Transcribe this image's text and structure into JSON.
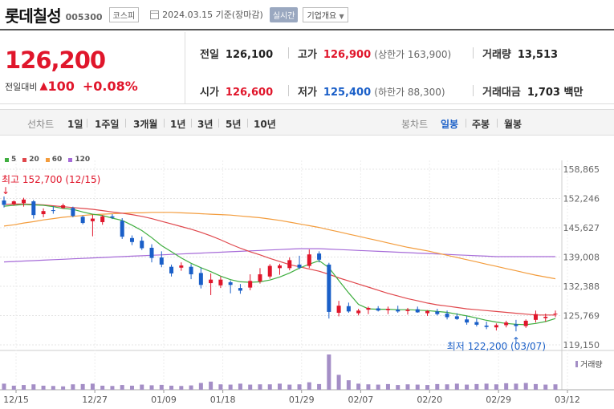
{
  "header": {
    "name": "롯데칠성",
    "code": "005300",
    "market": "코스피",
    "date": "2024.03.15  기준(장마감)",
    "realtime_label": "실시간",
    "overview_label": "기업개요"
  },
  "price": {
    "current": "126,200",
    "change_label": "전일대비",
    "change_arrow": "▲",
    "change_value": "100",
    "change_pct": "+0.08%"
  },
  "stats": {
    "prev_label": "전일",
    "prev_value": "126,100",
    "high_label": "고가",
    "high_value": "126,900",
    "upper_limit": "(상한가 163,900)",
    "volume_label": "거래량",
    "volume_value": "13,513",
    "open_label": "시가",
    "open_value": "126,600",
    "low_label": "저가",
    "low_value": "125,400",
    "lower_limit": "(하한가 88,300)",
    "amount_label": "거래대금",
    "amount_value": "1,703 백만"
  },
  "tabs": {
    "line_chart": "선차트",
    "periods": [
      "1일",
      "1주일",
      "3개월",
      "1년",
      "3년",
      "5년",
      "10년"
    ],
    "candle_chart": "봉차트",
    "candle_periods": [
      "일봉",
      "주봉",
      "월봉"
    ],
    "active_candle": "일봉"
  },
  "legend": [
    {
      "label": "5",
      "color": "#3fae3f"
    },
    {
      "label": "20",
      "color": "#e0474c"
    },
    {
      "label": "60",
      "color": "#f39c3c"
    },
    {
      "label": "120",
      "color": "#a66bd8"
    }
  ],
  "chart_data": {
    "type": "candlestick",
    "y_ticks": [
      "158,865",
      "152,246",
      "145,627",
      "139,008",
      "132,388",
      "125,769",
      "119,150"
    ],
    "ylim": [
      119150,
      158865
    ],
    "x_ticks": [
      "12/15",
      "12/27",
      "01/09",
      "01/18",
      "01/29",
      "02/07",
      "02/20",
      "02/29",
      "03/12"
    ],
    "x_tick_index": [
      0,
      8,
      15,
      21,
      29,
      35,
      42,
      49,
      56
    ],
    "annotations": {
      "high": {
        "label": "최고 152,700 (12/15)",
        "value": 152700,
        "index": 0
      },
      "low": {
        "label": "최저 122,200 (03/07)",
        "value": 122200,
        "index": 52
      }
    },
    "volume_label": "거래량",
    "candles": [
      {
        "o": 151800,
        "h": 152700,
        "l": 150200,
        "c": 150800
      },
      {
        "o": 151000,
        "h": 151800,
        "l": 150600,
        "c": 151600
      },
      {
        "o": 151200,
        "h": 152400,
        "l": 150400,
        "c": 152000
      },
      {
        "o": 151600,
        "h": 151900,
        "l": 147700,
        "c": 148500
      },
      {
        "o": 148700,
        "h": 150000,
        "l": 148000,
        "c": 149400
      },
      {
        "o": 149600,
        "h": 150500,
        "l": 148800,
        "c": 149500
      },
      {
        "o": 150100,
        "h": 151100,
        "l": 149900,
        "c": 150700
      },
      {
        "o": 150100,
        "h": 150400,
        "l": 148000,
        "c": 148300
      },
      {
        "o": 148100,
        "h": 148400,
        "l": 146400,
        "c": 146700
      },
      {
        "o": 147100,
        "h": 148600,
        "l": 143700,
        "c": 147700
      },
      {
        "o": 146900,
        "h": 148500,
        "l": 146300,
        "c": 148200
      },
      {
        "o": 148200,
        "h": 148700,
        "l": 147600,
        "c": 147900
      },
      {
        "o": 147200,
        "h": 147800,
        "l": 143100,
        "c": 143600
      },
      {
        "o": 143300,
        "h": 143900,
        "l": 141700,
        "c": 142400
      },
      {
        "o": 142700,
        "h": 143600,
        "l": 140600,
        "c": 141000
      },
      {
        "o": 141100,
        "h": 141900,
        "l": 137800,
        "c": 138800
      },
      {
        "o": 138900,
        "h": 140300,
        "l": 136700,
        "c": 137300
      },
      {
        "o": 136800,
        "h": 137300,
        "l": 134600,
        "c": 135300
      },
      {
        "o": 136600,
        "h": 137800,
        "l": 135900,
        "c": 137100
      },
      {
        "o": 136800,
        "h": 137400,
        "l": 134000,
        "c": 135100
      },
      {
        "o": 135400,
        "h": 136600,
        "l": 131900,
        "c": 132700
      },
      {
        "o": 133100,
        "h": 135300,
        "l": 130400,
        "c": 133900
      },
      {
        "o": 132600,
        "h": 134600,
        "l": 132000,
        "c": 133900
      },
      {
        "o": 133300,
        "h": 133700,
        "l": 130800,
        "c": 132700
      },
      {
        "o": 132000,
        "h": 132900,
        "l": 130700,
        "c": 131400
      },
      {
        "o": 132100,
        "h": 135100,
        "l": 131500,
        "c": 133600
      },
      {
        "o": 133500,
        "h": 136500,
        "l": 133000,
        "c": 135100
      },
      {
        "o": 134600,
        "h": 137400,
        "l": 134100,
        "c": 137000
      },
      {
        "o": 136500,
        "h": 137500,
        "l": 135000,
        "c": 137100
      },
      {
        "o": 136500,
        "h": 138900,
        "l": 136000,
        "c": 138300
      },
      {
        "o": 137300,
        "h": 139300,
        "l": 136300,
        "c": 136600
      },
      {
        "o": 137000,
        "h": 140700,
        "l": 136500,
        "c": 139600
      },
      {
        "o": 139800,
        "h": 140300,
        "l": 137800,
        "c": 138400
      },
      {
        "o": 137300,
        "h": 137700,
        "l": 125100,
        "c": 126600
      },
      {
        "o": 126400,
        "h": 129100,
        "l": 125600,
        "c": 128000
      },
      {
        "o": 127900,
        "h": 128700,
        "l": 126400,
        "c": 126700
      },
      {
        "o": 126300,
        "h": 127300,
        "l": 125800,
        "c": 126900
      },
      {
        "o": 127100,
        "h": 127800,
        "l": 126100,
        "c": 127500
      },
      {
        "o": 127400,
        "h": 127900,
        "l": 126700,
        "c": 126900
      },
      {
        "o": 127000,
        "h": 127800,
        "l": 126100,
        "c": 127300
      },
      {
        "o": 127100,
        "h": 128000,
        "l": 126400,
        "c": 126700
      },
      {
        "o": 126800,
        "h": 127500,
        "l": 126000,
        "c": 127100
      },
      {
        "o": 127200,
        "h": 127800,
        "l": 126400,
        "c": 126500
      },
      {
        "o": 126300,
        "h": 127000,
        "l": 125700,
        "c": 126800
      },
      {
        "o": 126700,
        "h": 127300,
        "l": 125800,
        "c": 126100
      },
      {
        "o": 126200,
        "h": 126900,
        "l": 124900,
        "c": 125400
      },
      {
        "o": 125600,
        "h": 126300,
        "l": 124800,
        "c": 125000
      },
      {
        "o": 124900,
        "h": 125700,
        "l": 123700,
        "c": 124200
      },
      {
        "o": 124300,
        "h": 125100,
        "l": 123300,
        "c": 123700
      },
      {
        "o": 123500,
        "h": 124400,
        "l": 122700,
        "c": 123200
      },
      {
        "o": 123100,
        "h": 124000,
        "l": 122400,
        "c": 123600
      },
      {
        "o": 123600,
        "h": 124600,
        "l": 123100,
        "c": 124200
      },
      {
        "o": 123800,
        "h": 124800,
        "l": 122200,
        "c": 123400
      },
      {
        "o": 123400,
        "h": 124900,
        "l": 123000,
        "c": 124600
      },
      {
        "o": 124800,
        "h": 126900,
        "l": 124200,
        "c": 126100
      },
      {
        "o": 125200,
        "h": 126200,
        "l": 124400,
        "c": 125500
      },
      {
        "o": 126100,
        "h": 126900,
        "l": 125400,
        "c": 126200
      }
    ],
    "volumes": [
      45,
      30,
      35,
      40,
      30,
      28,
      25,
      40,
      42,
      45,
      30,
      28,
      35,
      30,
      38,
      33,
      36,
      30,
      28,
      32,
      50,
      60,
      40,
      38,
      45,
      38,
      40,
      40,
      45,
      38,
      40,
      55,
      42,
      260,
      110,
      70,
      45,
      40,
      38,
      42,
      35,
      40,
      38,
      35,
      42,
      40,
      45,
      38,
      42,
      45,
      40,
      48,
      45,
      50,
      42,
      38,
      40
    ],
    "ma5": [
      150500,
      150700,
      150900,
      150800,
      150700,
      150400,
      150000,
      149800,
      149200,
      148700,
      148400,
      147800,
      147300,
      146200,
      145000,
      143400,
      141600,
      140200,
      138800,
      137600,
      136600,
      135700,
      134700,
      133900,
      133400,
      133300,
      133400,
      133800,
      134500,
      135400,
      136500,
      137400,
      138200,
      136600,
      133700,
      130900,
      128300,
      127300,
      127200,
      127200,
      127100,
      127100,
      127000,
      126900,
      126700,
      126500,
      126100,
      125700,
      125200,
      124700,
      124300,
      124000,
      123800,
      123700,
      124000,
      124400,
      125100
    ],
    "ma20": [
      150900,
      151000,
      151000,
      150900,
      150800,
      150600,
      150400,
      150200,
      150000,
      149800,
      149500,
      149200,
      148900,
      148600,
      148200,
      147700,
      147100,
      146500,
      145900,
      145300,
      144600,
      143800,
      142900,
      141900,
      141000,
      140200,
      139500,
      138700,
      138000,
      137300,
      136800,
      136300,
      135800,
      135100,
      134300,
      133600,
      132900,
      132200,
      131500,
      130800,
      130200,
      129600,
      129100,
      128600,
      128200,
      127900,
      127600,
      127300,
      127100,
      126900,
      126700,
      126500,
      126300,
      126100,
      125900,
      125900,
      125900
    ],
    "ma60": [
      146000,
      146300,
      146700,
      147000,
      147400,
      147700,
      148000,
      148200,
      148400,
      148600,
      148700,
      148800,
      148900,
      149000,
      149000,
      149100,
      149100,
      149100,
      149000,
      148900,
      148800,
      148700,
      148600,
      148500,
      148300,
      148100,
      147900,
      147600,
      147300,
      146900,
      146500,
      146100,
      145700,
      145200,
      144700,
      144200,
      143700,
      143200,
      142700,
      142200,
      141700,
      141200,
      140800,
      140400,
      139900,
      139400,
      138900,
      138400,
      137900,
      137400,
      136900,
      136400,
      135900,
      135400,
      134900,
      134500,
      134100
    ],
    "ma120": [
      137900,
      138000,
      138100,
      138200,
      138300,
      138400,
      138500,
      138600,
      138700,
      138800,
      138900,
      139000,
      139100,
      139200,
      139300,
      139400,
      139500,
      139600,
      139700,
      139800,
      139900,
      140000,
      140100,
      140200,
      140300,
      140400,
      140500,
      140600,
      140700,
      140800,
      140900,
      140900,
      140900,
      140800,
      140700,
      140600,
      140500,
      140400,
      140300,
      140200,
      140100,
      140000,
      139900,
      139800,
      139700,
      139600,
      139500,
      139400,
      139300,
      139200,
      139100,
      139100,
      139100,
      139100,
      139100,
      139100,
      139100
    ]
  }
}
